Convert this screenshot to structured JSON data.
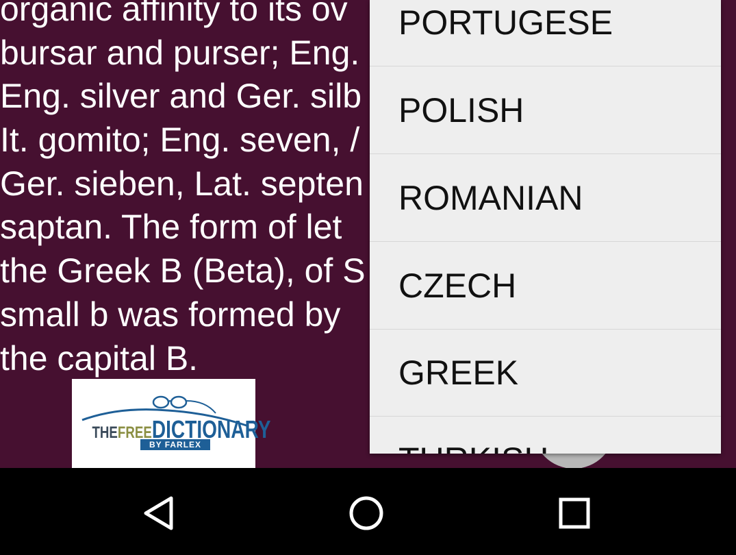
{
  "article": {
    "lines": [
      "organic affinity to its ov",
      "bursar and purser; Eng.",
      "Eng. silver and Ger. silb",
      "It. gomito; Eng. seven, /",
      "Ger. sieben, Lat. septen",
      "saptan. The form of let",
      "the Greek B (Beta), of S",
      "small b was formed by",
      "the capital B."
    ]
  },
  "logo": {
    "the": "THE",
    "free": "FREE",
    "dictionary": "DICTIONARY",
    "by": "BY FARLEX"
  },
  "language_menu": {
    "items": [
      "PORTUGESE",
      "POLISH",
      "ROMANIAN",
      "CZECH",
      "GREEK",
      "TURKISH"
    ]
  },
  "colors": {
    "background": "#461030",
    "menu": "#eeeeee",
    "navbar": "#000000",
    "logo_blue": "#1e5f97",
    "logo_olive": "#8b8f43"
  },
  "nav": {
    "back_icon": "back-icon",
    "home_icon": "home-icon",
    "recents_icon": "recents-icon"
  }
}
